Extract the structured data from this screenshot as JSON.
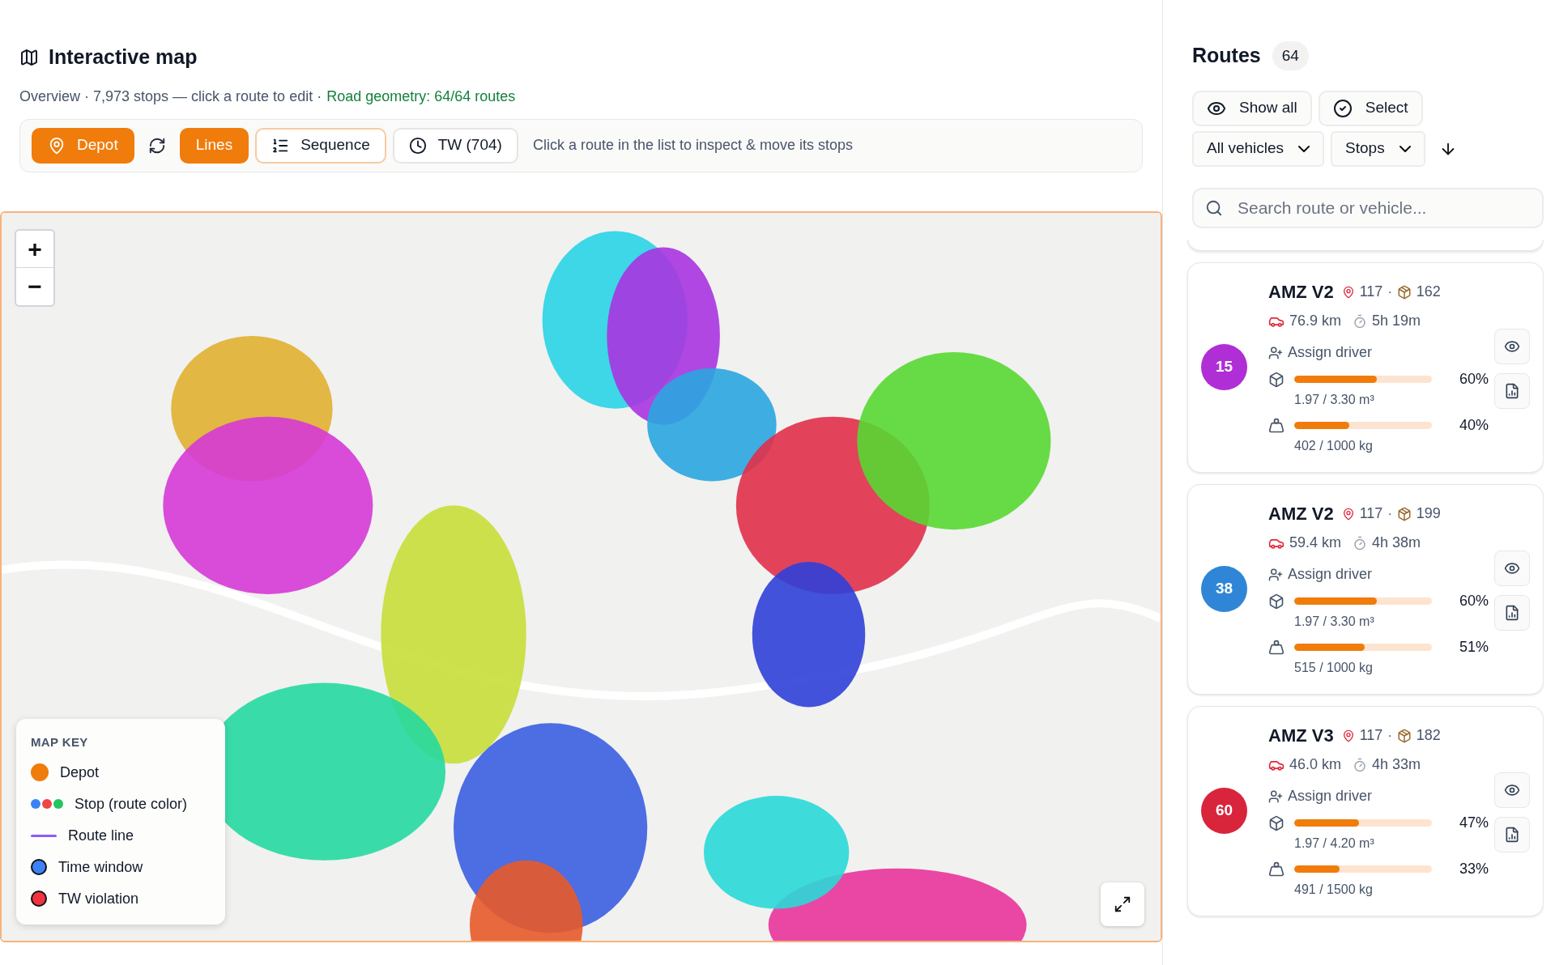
{
  "header": {
    "title": "Interactive map",
    "subtitle": "Overview · 7,973 stops — click a route to edit ·",
    "geometry_status": "Road geometry: 64/64 routes"
  },
  "toolbar": {
    "buttons": [
      {
        "kind": "icon-label",
        "label": "Depot",
        "on": true,
        "focused": false
      },
      {
        "kind": "icon-only"
      },
      {
        "kind": "label",
        "label": "Lines",
        "on": true,
        "focused": false
      },
      {
        "kind": "icon-label",
        "label": "Sequence",
        "on": false,
        "focused": true
      },
      {
        "kind": "icon-label",
        "label": "TW (704)",
        "on": false,
        "focused": false
      }
    ],
    "hint": "Click a route in the list to inspect & move its stops"
  },
  "map": {
    "zoom_in": "+",
    "zoom_out": "−",
    "legend": {
      "title": "MAP KEY",
      "items": [
        {
          "kind": "dot",
          "label": "Depot",
          "color": "#f07c0c"
        },
        {
          "kind": "dots",
          "label": "Stop (route color)"
        },
        {
          "kind": "line",
          "label": "Route line",
          "color": "#8b5cf6"
        },
        {
          "kind": "ring",
          "label": "Time window",
          "color": "#3b82f6"
        },
        {
          "kind": "ring",
          "label": "TW violation",
          "color": "#ef3340"
        }
      ]
    }
  },
  "routes": {
    "title": "Routes",
    "count": "64",
    "actions": [
      {
        "label": "Show all"
      },
      {
        "label": "Select"
      }
    ],
    "filters": [
      {
        "value": "All vehicles"
      },
      {
        "value": "Stops"
      }
    ],
    "search": {
      "placeholder": "Search route or vehicle..."
    },
    "cards": [
      {
        "separator": "·",
        "number": "15",
        "color": "#b02ed6",
        "name": "AMZ V2",
        "stops": "117",
        "parcels": "162",
        "distance": "76.9 km",
        "duration": "5h 19m",
        "driver": "Assign driver",
        "volume": {
          "level": 0.6,
          "percent": "60%",
          "text": "1.97 / 3.30 m³"
        },
        "weight": {
          "level": 0.4,
          "percent": "40%",
          "text": "402 / 1000 kg"
        }
      },
      {
        "separator": "·",
        "number": "38",
        "color": "#2f86d6",
        "name": "AMZ V2",
        "stops": "117",
        "parcels": "199",
        "distance": "59.4 km",
        "duration": "4h 38m",
        "driver": "Assign driver",
        "volume": {
          "level": 0.6,
          "percent": "60%",
          "text": "1.97 / 3.30 m³"
        },
        "weight": {
          "level": 0.51,
          "percent": "51%",
          "text": "515 / 1000 kg"
        }
      },
      {
        "separator": "·",
        "number": "60",
        "color": "#d8253c",
        "name": "AMZ V3",
        "stops": "117",
        "parcels": "182",
        "distance": "46.0 km",
        "duration": "4h 33m",
        "driver": "Assign driver",
        "volume": {
          "level": 0.47,
          "percent": "47%",
          "text": "1.97 / 4.20 m³"
        },
        "weight": {
          "level": 0.33,
          "percent": "33%",
          "text": "491 / 1500 kg"
        }
      }
    ]
  }
}
